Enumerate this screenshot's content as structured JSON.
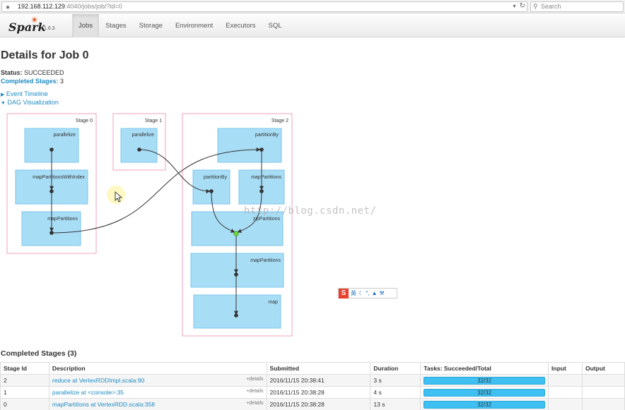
{
  "browser": {
    "url_host": "192.168.112.129",
    "url_rest": ":4040/jobs/job/?id=0",
    "search_placeholder": "Search"
  },
  "navbar": {
    "brand": "Spark",
    "version": "1.6.3",
    "tabs": [
      {
        "label": "Jobs",
        "active": true
      },
      {
        "label": "Stages"
      },
      {
        "label": "Storage"
      },
      {
        "label": "Environment"
      },
      {
        "label": "Executors"
      },
      {
        "label": "SQL"
      }
    ]
  },
  "job": {
    "title": "Details for Job 0",
    "status_label": "Status:",
    "status_value": "SUCCEEDED",
    "completed_label": "Completed Stages:",
    "completed_value": "3",
    "event_timeline": "Event Timeline",
    "dag_visualization": "DAG Visualization"
  },
  "dag": {
    "stage_labels": [
      "Stage 0",
      "Stage 1",
      "Stage 2"
    ],
    "nodes": {
      "s0_parallelize": "parallelize",
      "s0_mappartitionswithindex": "mapPartitionsWithIndex",
      "s0_mappartitions": "mapPartitions",
      "s1_parallelize": "parallelize",
      "s2_partitionby_top": "partitionBy",
      "s2_partitionby": "partitionBy",
      "s2_mappartitions_a": "mapPartitions",
      "s2_zippartitions": "zipPartitions",
      "s2_mappartitions_b": "mapPartitions",
      "s2_map": "map"
    },
    "colors": {
      "stage_border": "#f2a0bf",
      "node_fill": "#a8ddf6",
      "node_border": "#7cc6ec",
      "edge": "#333333"
    }
  },
  "watermark": "http://blog.csdn.net/",
  "ime": {
    "logo": "S",
    "lang": "英"
  },
  "completed_stages": {
    "title": "Completed Stages (3)",
    "columns": [
      "Stage Id",
      "Description",
      "Submitted",
      "Duration",
      "Tasks: Succeeded/Total",
      "Input",
      "Output"
    ],
    "details_label": "+details",
    "rows": [
      {
        "id": "2",
        "description": "reduce at VertexRDDImpl.scala:90",
        "submitted": "2016/11/15 20:38:41",
        "duration": "3 s",
        "tasks": "32/32",
        "progress": 1.0
      },
      {
        "id": "1",
        "description": "parallelize at <console>:35",
        "submitted": "2016/11/15 20:38:28",
        "duration": "4 s",
        "tasks": "32/32",
        "progress": 1.0
      },
      {
        "id": "0",
        "description": "mapPartitions at VertexRDD.scala:358",
        "submitted": "2016/11/15 20:38:28",
        "duration": "13 s",
        "tasks": "32/32",
        "progress": 1.0
      }
    ]
  }
}
